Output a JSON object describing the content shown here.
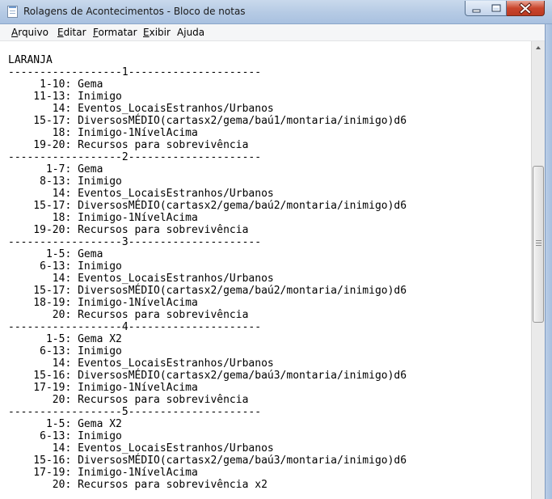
{
  "window": {
    "title": "Rolagens de Acontecimentos - Bloco de notas"
  },
  "menu": {
    "items": [
      {
        "key": "A",
        "rest": "rquivo"
      },
      {
        "key": "E",
        "rest": "ditar"
      },
      {
        "key": "F",
        "rest": "ormatar"
      },
      {
        "key": "E",
        "rest": "xibir"
      },
      {
        "key": "Aj",
        "rest": "uda",
        "underline_index": 1
      }
    ]
  },
  "document": {
    "lines": [
      "LARANJA",
      "------------------1---------------------",
      "     1-10: Gema",
      "    11-13: Inimigo",
      "       14: Eventos_LocaisEstranhos/Urbanos",
      "    15-17: DiversosMÉDIO(cartasx2/gema/baú1/montaria/inimigo)d6",
      "       18: Inimigo-1NívelAcima",
      "    19-20: Recursos para sobrevivência",
      "------------------2---------------------",
      "      1-7: Gema",
      "     8-13: Inimigo",
      "       14: Eventos_LocaisEstranhos/Urbanos",
      "    15-17: DiversosMÉDIO(cartasx2/gema/baú2/montaria/inimigo)d6",
      "       18: Inimigo-1NívelAcima",
      "    19-20: Recursos para sobrevivência",
      "------------------3---------------------",
      "      1-5: Gema",
      "     6-13: Inimigo",
      "       14: Eventos_LocaisEstranhos/Urbanos",
      "    15-17: DiversosMÉDIO(cartasx2/gema/baú2/montaria/inimigo)d6",
      "    18-19: Inimigo-1NívelAcima",
      "       20: Recursos para sobrevivência",
      "------------------4---------------------",
      "      1-5: Gema X2",
      "     6-13: Inimigo",
      "       14: Eventos_LocaisEstranhos/Urbanos",
      "    15-16: DiversosMÉDIO(cartasx2/gema/baú3/montaria/inimigo)d6",
      "    17-19: Inimigo-1NívelAcima",
      "       20: Recursos para sobrevivência",
      "------------------5---------------------",
      "      1-5: Gema X2",
      "     6-13: Inimigo",
      "       14: Eventos_LocaisEstranhos/Urbanos",
      "    15-16: DiversosMÉDIO(cartasx2/gema/baú3/montaria/inimigo)d6",
      "    17-19: Inimigo-1NívelAcima",
      "       20: Recursos para sobrevivência x2"
    ]
  },
  "icons": {
    "app": "notepad-icon",
    "minimize": "minimize-icon",
    "maximize": "maximize-icon",
    "close": "close-icon",
    "scroll_up": "arrow-up-icon"
  },
  "colors": {
    "title_bar": "#b5cae4",
    "close_button": "#c9462d",
    "menu_bar": "#f5f6f7",
    "editor_bg": "#ffffff"
  }
}
